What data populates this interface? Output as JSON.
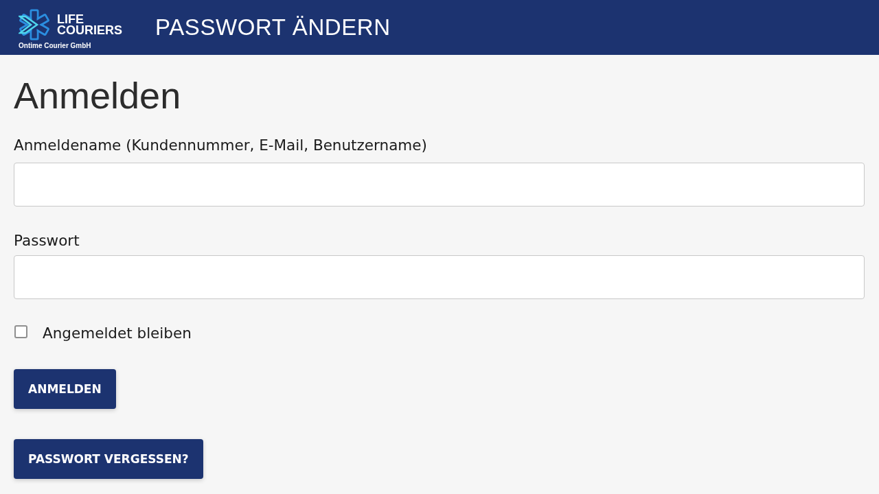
{
  "header": {
    "logo": {
      "wordmark": "LIFE COURIERS",
      "tagline": "Ontime Courier GmbH"
    },
    "title": "PASSWORT ÄNDERN"
  },
  "heading": "Anmelden",
  "fields": [
    {
      "label": "Anmeldename (Kundennummer, E-Mail, Benutzername)"
    },
    {
      "label": "Passwort"
    }
  ],
  "remember": {
    "label": "Angemeldet bleiben",
    "checked": false
  },
  "buttons": [
    "ANMELDEN",
    "PASSWORT VERGESSEN?"
  ]
}
